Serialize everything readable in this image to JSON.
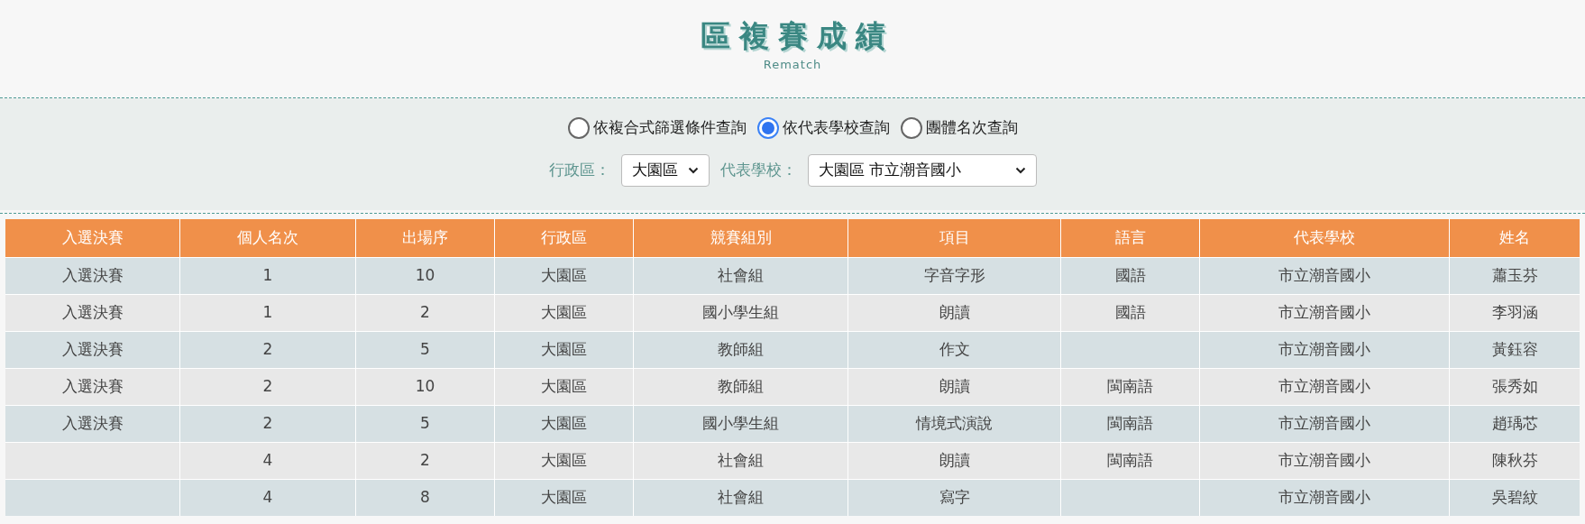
{
  "header": {
    "title": "區複賽成績",
    "subtitle": "Rematch"
  },
  "query_modes": [
    {
      "label": "依複合式篩選條件查詢",
      "selected": false
    },
    {
      "label": "依代表學校查詢",
      "selected": true
    },
    {
      "label": "團體名次查詢",
      "selected": false
    }
  ],
  "filters": [
    {
      "label": "行政區：",
      "value": "大園區",
      "kind": "short"
    },
    {
      "label": "代表學校：",
      "value": "大園區 市立潮音國小",
      "kind": "wide"
    }
  ],
  "table": {
    "columns": [
      "入選決賽",
      "個人名次",
      "出場序",
      "行政區",
      "競賽組別",
      "項目",
      "語言",
      "代表學校",
      "姓名"
    ],
    "rows": [
      [
        "入選決賽",
        "1",
        "10",
        "大園區",
        "社會組",
        "字音字形",
        "國語",
        "市立潮音國小",
        "蕭玉芬"
      ],
      [
        "入選決賽",
        "1",
        "2",
        "大園區",
        "國小學生組",
        "朗讀",
        "國語",
        "市立潮音國小",
        "李羽涵"
      ],
      [
        "入選決賽",
        "2",
        "5",
        "大園區",
        "教師組",
        "作文",
        "",
        "市立潮音國小",
        "黃鈺容"
      ],
      [
        "入選決賽",
        "2",
        "10",
        "大園區",
        "教師組",
        "朗讀",
        "閩南語",
        "市立潮音國小",
        "張秀如"
      ],
      [
        "入選決賽",
        "2",
        "5",
        "大園區",
        "國小學生組",
        "情境式演說",
        "閩南語",
        "市立潮音國小",
        "趙瑀芯"
      ],
      [
        "",
        "4",
        "2",
        "大園區",
        "社會組",
        "朗讀",
        "閩南語",
        "市立潮音國小",
        "陳秋芬"
      ],
      [
        "",
        "4",
        "8",
        "大園區",
        "社會組",
        "寫字",
        "",
        "市立潮音國小",
        "吳碧紋"
      ]
    ]
  }
}
